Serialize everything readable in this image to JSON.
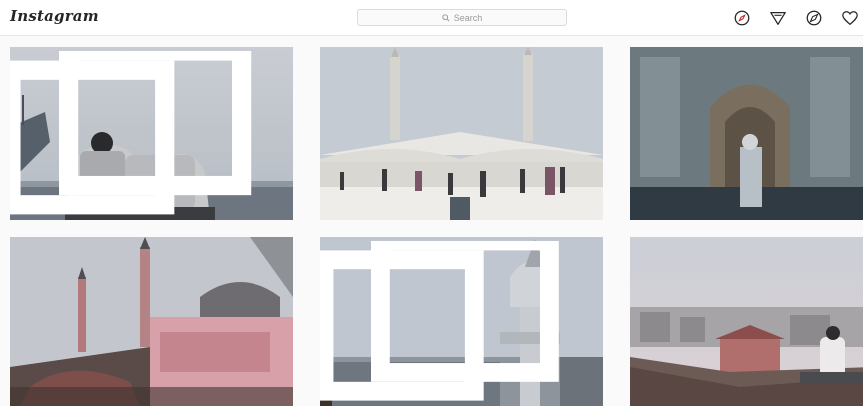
{
  "header": {
    "logo_text": "Instagram",
    "search_placeholder": "Search"
  },
  "nav_icons": [
    "compass-icon",
    "send-icon",
    "explore-icon",
    "heart-icon"
  ],
  "posts": [
    {
      "name": "post-bosphorus-ferry",
      "has_multi_badge": true
    },
    {
      "name": "post-mosque-courtyard",
      "has_multi_badge": false
    },
    {
      "name": "post-tiled-mihrab",
      "has_multi_badge": false
    },
    {
      "name": "post-hagia-sophia",
      "has_multi_badge": false
    },
    {
      "name": "post-mosque-dome-tower",
      "has_multi_badge": true
    },
    {
      "name": "post-rooftop-view",
      "has_multi_badge": false
    }
  ],
  "colors": {
    "background": "#fafafa",
    "topbar": "#ffffff",
    "border": "#dbdbdb"
  }
}
